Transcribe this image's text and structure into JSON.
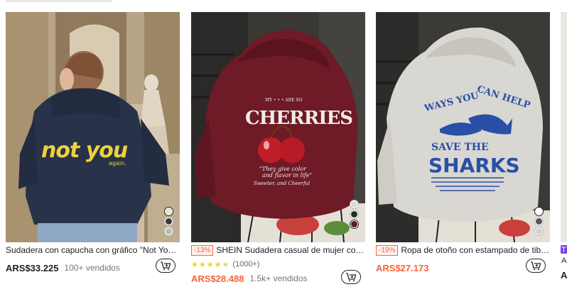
{
  "products": [
    {
      "title": "Sudadera con capucha con gráfico \"Not You\", s...",
      "discount": "",
      "price": "ARS$33.225",
      "sold": "100+ vendidos",
      "rating": null,
      "rating_count": "",
      "graphic_text": "not you",
      "graphic_sub": "again.",
      "swatches": [
        "#e8e4c8",
        "#3a3a3a",
        "#b9b9b9"
      ],
      "selected_swatch": 0
    },
    {
      "title": "SHEIN Sudadera casual de mujer con est...",
      "discount": "-13%",
      "price": "ARS$28.488",
      "sold": "1.5k+ vendidos",
      "rating": 4.5,
      "rating_count": "(1000+)",
      "graphic_text": "CHERRIES",
      "graphic_sub": "Sweeter, and Cheerful",
      "swatches": [
        "#d9d9d9",
        "#2a2a2a",
        "#5a1a22"
      ],
      "selected_swatch": 2
    },
    {
      "title": "Ropa de otoño con estampado de tiburó...",
      "discount": "-19%",
      "price": "ARS$27.173",
      "sold": "",
      "rating": null,
      "rating_count": "",
      "graphic_text": "SHARKS",
      "graphic_sub": "WAYS YOU CAN HELP",
      "swatches": [
        "#ffffff",
        "#555555",
        "#d0d0cc"
      ],
      "selected_swatch": 0
    }
  ],
  "partial_card": {
    "badge": "T",
    "title": "Af",
    "price": "A"
  },
  "icons": {
    "cart": "add-to-cart-icon",
    "star": "star-icon"
  },
  "colors": {
    "sale": "#fa6338",
    "star": "#facf19"
  }
}
